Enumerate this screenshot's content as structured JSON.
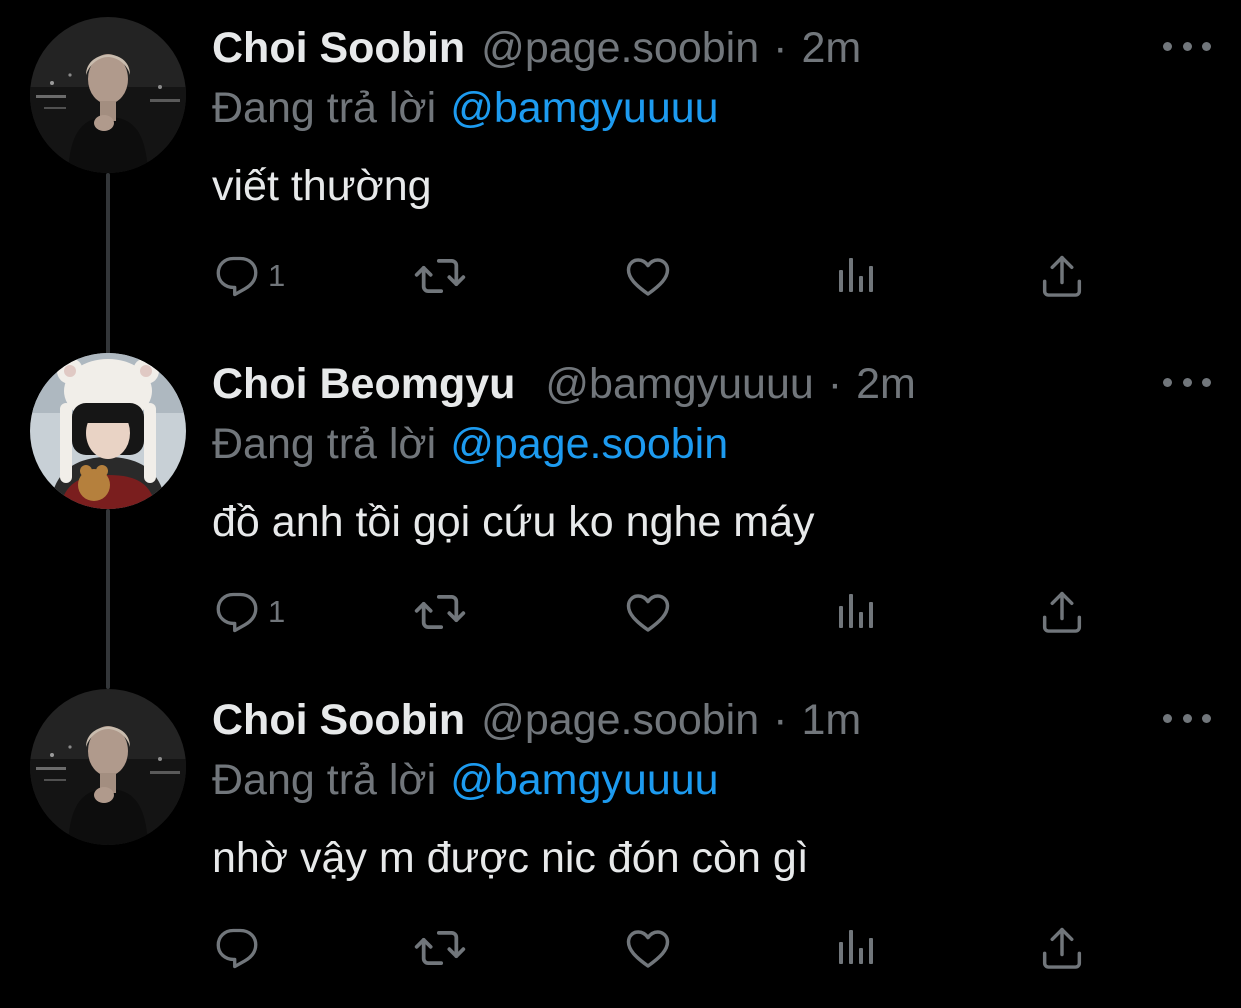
{
  "tweets": [
    {
      "name": "Choi Soobin",
      "handle": "@page.soobin",
      "separator": "·",
      "time": "2m",
      "reply_prefix": "Đang trả lời",
      "reply_to": "@bamgyuuuu",
      "text": "viết thường",
      "reply_count": "1"
    },
    {
      "name": "Choi Beomgyu",
      "handle": "@bamgyuuuu",
      "separator": "·",
      "time": "2m",
      "reply_prefix": "Đang trả lời",
      "reply_to": "@page.soobin",
      "text": "đồ anh tồi gọi cứu ko nghe máy",
      "reply_count": "1"
    },
    {
      "name": "Choi Soobin",
      "handle": "@page.soobin",
      "separator": "·",
      "time": "1m",
      "reply_prefix": "Đang trả lời",
      "reply_to": "@bamgyuuuu",
      "text": "nhờ vậy m được nic đón còn gì",
      "reply_count": ""
    }
  ],
  "icons": {
    "reply": "reply-icon",
    "retweet": "retweet-icon",
    "like": "heart-icon",
    "views": "analytics-icon",
    "share": "share-icon",
    "more": "more-icon"
  },
  "colors": {
    "background": "#000000",
    "name": "#e7e9ea",
    "muted": "#71767b",
    "mention": "#1d9bf0",
    "thread_line": "#333639"
  }
}
